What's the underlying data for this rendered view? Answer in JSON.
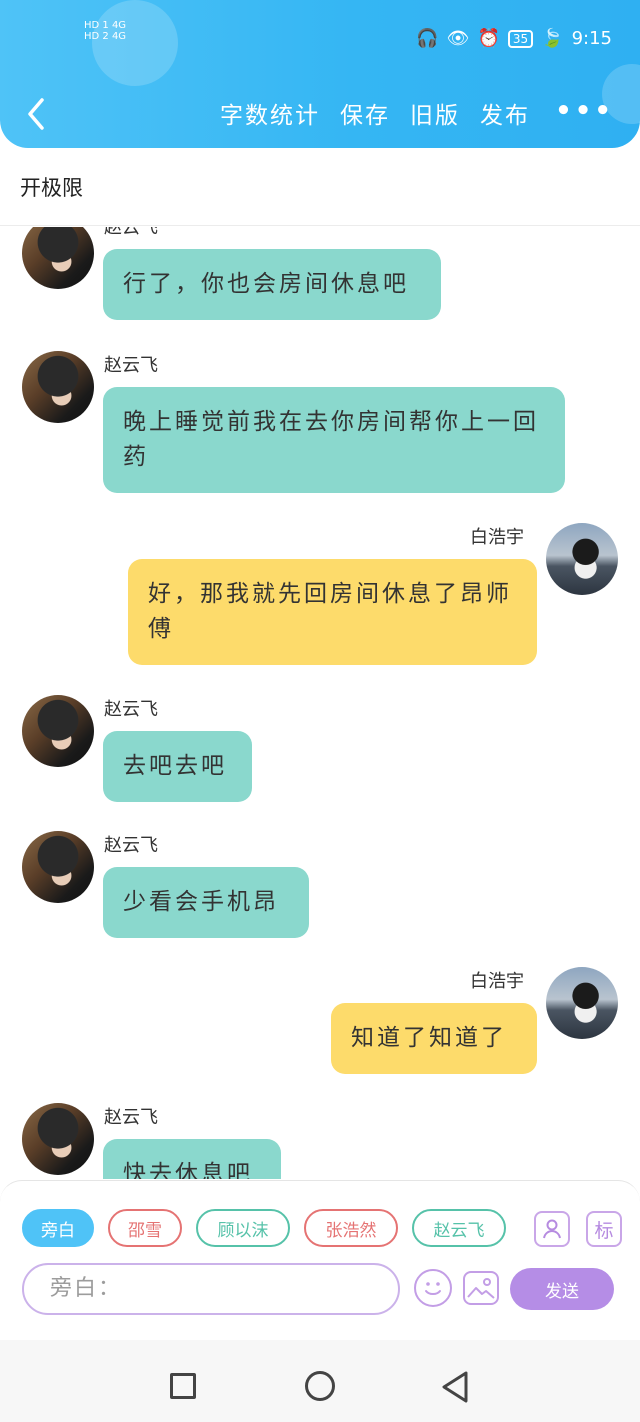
{
  "status_bar": {
    "network_left": "HD 1 4G",
    "network_left2": "HD 2 4G",
    "battery": "35",
    "time": "9:15"
  },
  "nav": {
    "actions": [
      "字数统计",
      "保存",
      "旧版",
      "发布"
    ],
    "more": "•••"
  },
  "doc_title": "开极限",
  "messages": [
    {
      "sender": "赵云飞",
      "text": "行了，你也会房间休息吧",
      "side": "left"
    },
    {
      "sender": "赵云飞",
      "text": "晚上睡觉前我在去你房间帮你上一回药",
      "side": "left"
    },
    {
      "sender": "白浩宇",
      "text": "好，那我就先回房间休息了昂师傅",
      "side": "right"
    },
    {
      "sender": "赵云飞",
      "text": "去吧去吧",
      "side": "left"
    },
    {
      "sender": "赵云飞",
      "text": "少看会手机昂",
      "side": "left"
    },
    {
      "sender": "白浩宇",
      "text": "知道了知道了",
      "side": "right"
    },
    {
      "sender": "赵云飞",
      "text": "快去休息吧",
      "side": "left"
    }
  ],
  "composer": {
    "roles": [
      "旁白",
      "邵雪",
      "顾以沫",
      "张浩然",
      "赵云飞"
    ],
    "tag_button": "标",
    "input_placeholder": "旁白：",
    "send_label": "发送"
  },
  "colors": {
    "header": "#35b6f3",
    "teal_bubble": "#8ad8cd",
    "yellow_bubble": "#fddb6b",
    "send": "#b58de6"
  }
}
